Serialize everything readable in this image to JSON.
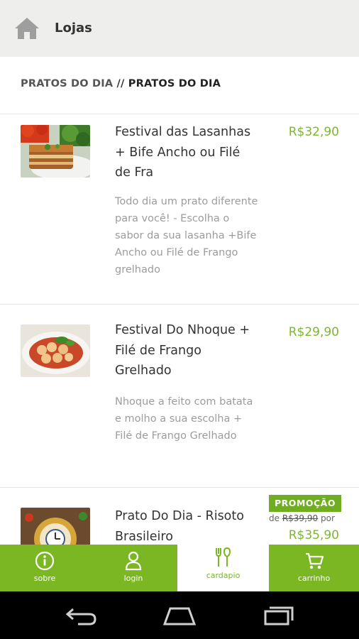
{
  "topbar": {
    "title": "Lojas",
    "icon": "home-icon"
  },
  "breadcrumb": {
    "part1": "PRATOS DO DIA",
    "separator": " // ",
    "part2": "PRATOS DO DIA"
  },
  "items": [
    {
      "title": "Festival das Lasanhas + Bife Ancho ou Filé de Fra",
      "description": "Todo dia um prato diferente para você! - Escolha o sabor da sua lasanha +Bife Ancho ou Filé de Frango grelhado",
      "price": "R$32,90"
    },
    {
      "title": "Festival Do Nhoque + Filé de Frango Grelhado",
      "description": "Nhoque a feito com batata e molho a sua escolha + Filé de Frango Grelhado",
      "price": "R$29,90"
    },
    {
      "title": "Prato Do Dia - Risoto Brasileiro",
      "badge": "PROMOÇÃO",
      "old_price_prefix": "de",
      "old_price": "R$39,90",
      "old_price_suffix": "por",
      "price": "R$35,90"
    }
  ],
  "bottom_nav": [
    {
      "label": "sobre",
      "icon": "info-icon"
    },
    {
      "label": "login",
      "icon": "user-icon"
    },
    {
      "label": "cardapio",
      "icon": "cutlery-icon",
      "active": true
    },
    {
      "label": "carrinho",
      "icon": "cart-icon"
    }
  ],
  "colors": {
    "accent": "#7bb623",
    "price": "#7cb927",
    "promo": "#6fae1e"
  }
}
